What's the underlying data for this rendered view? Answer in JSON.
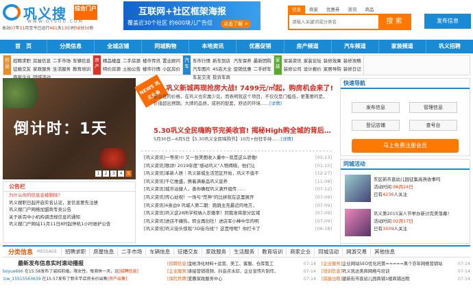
{
  "logo": {
    "name": "巩义搜",
    "sub": "综合门户",
    "url": "WWW.GYSOU.COM"
  },
  "counter": {
    "prefix": "本站",
    "year": "07",
    "mid1": "年",
    "month": "11",
    "mid2": "月至今已运行",
    "days": "461",
    "mid3": "天",
    "hours": "13",
    "mid4": "小时",
    "mins": "58",
    "mid5": "分",
    "secs": "50",
    "suffix": "秒"
  },
  "banner": {
    "title": "互联网+社区框架海报",
    "sub": "覆盖近30个社区 约600块儿广告位",
    "cta": "点击了解 >"
  },
  "search": {
    "tabs": [
      "信息",
      "商家",
      "优惠券",
      "资讯",
      "商品"
    ],
    "placeholder": "请输入关键词或分类名",
    "button": "搜 索"
  },
  "publish_button": "发布信息",
  "nav": [
    "首　页",
    "分类信息",
    "全城店铺",
    "同城购物",
    "本地资讯",
    "优惠促销",
    "房产频道",
    "汽车频道",
    "家装频道",
    "巩义招聘"
  ],
  "categories": [
    {
      "tag": "信息",
      "color": "#f08a1c",
      "links": [
        "招聘求职",
        "房屋信息",
        "二手市场",
        "车辆信息",
        "征婚交友",
        "家政服务",
        "生活服务",
        "教育培训",
        "商家企业",
        "同城活动"
      ]
    },
    {
      "tag": "房产",
      "color": "#d9322a",
      "links": [
        "精品楼盘",
        "二手房源",
        "楼市传讯",
        "置业顾问",
        "特价房源",
        "土拍公告",
        "楼市行情",
        "小区房价"
      ]
    },
    {
      "tag": "汽车",
      "color": "#1a8ad4",
      "links": [
        "车市行情",
        "新车到店",
        "汽车保养",
        "最新团购",
        "汽车图片",
        "4S店大全",
        "促销优惠",
        "二手好车",
        "车友交流",
        "投诉车商"
      ]
    },
    {
      "tag": "家装",
      "color": "#5aa832",
      "links": [
        "家装资讯",
        "家装论坛",
        "装修效果",
        "装修攻略",
        "装修公司",
        "设计报价",
        "家居导购",
        "装修日记"
      ]
    }
  ],
  "slide": {
    "text": "倒计时：1天",
    "pages": [
      "1",
      "2",
      "3",
      "4",
      "5"
    ],
    "active": 4
  },
  "notice": {
    "title": "公告栏",
    "items": [
      "为什么你的信息会被删除?",
      "巩义搜职日起开启实名认证，发信息要先注册",
      "巩义搜门户网络加盟商专卖公告",
      "关于拆完中小机构调违规信息的通知",
      "巩义搜门户网站11月11日8时起停机1小时维护公告"
    ]
  },
  "headline": {
    "badge": "NEWS 巩义头条",
    "h1": "巩义新城再现抢房大战! 7499元/㎡起，购房机会来了!",
    "d1": "这么低的价格，在巩义也实属少见。而表明就这个项目，不仅仅是门槛低，更重要的是，价值超出预期。大牌的品质，成熟的配套，舒适的环境……",
    "d1_more": "[详情]",
    "h2": "5.30巩义全民嗨购节完美收官! 揭秘High购全城的背后…",
    "d2": "5月30日—6月5日【5.30巩义全民嗨购节】10万+份狂手持……",
    "d2_more": "[详情]"
  },
  "news": [
    {
      "t": "[巩义资讯]一等奖!!! 又一张美图收入囊中~就是这么骄傲!",
      "d": "[05-13]"
    },
    {
      "t": "[巩义资讯]歌颂! 2019年度\"感动巩义\"人物揭晓，他们让",
      "d": "[01-15]"
    },
    {
      "t": "[巩义资讯]革新人居｜巩义新城生活范区开始，巩义不值不",
      "d": "[12-27]"
    },
    {
      "t": "[巩义资讯]千亿推盛，携着满春品巩义宣养",
      "d": "[11-08]"
    },
    {
      "t": "[巩义资讯]城市治捷人，善你确程巩义满开组传……",
      "d": "[07-12]"
    },
    {
      "t": "[巩义资讯]传心幼祝！一场与\"荒神\"的比拼就在这里展开",
      "d": "[07-09]"
    },
    {
      "t": "[巩义资讯]4身边9 巩城人第二期：跑跳主充最近的地方，",
      "d": "[07-09]"
    },
    {
      "t": "[巩义资讯]巩义这28所学校纳入农缴率！同我准将部分区域",
      "d": "[07-09]"
    },
    {
      "t": "[巩义资讯]进店不嫌热，转业再创社！进店军小棒中华的明",
      "d": "[07-09]"
    },
    {
      "t": "[巩义资讯]巩义街头惊现\"3D街马线\"！这是啥呢？你打卡了",
      "d": "[06-18]"
    }
  ],
  "quick": {
    "title": "快速导航",
    "items": [
      "发布信息",
      "管理信息",
      "登记店铺",
      "查号台"
    ],
    "register": "马上免费注册会员"
  },
  "activity": {
    "title": "同城活动",
    "items": [
      {
        "name": "东区新市直幼儿园征集高燕收事吗",
        "time_label": "活动时间:",
        "time": "06月24日",
        "count_prefix": "已有",
        "count": "4236",
        "count_suffix": "人关注"
      },
      {
        "name": "巩义第2015演人节举办新讨完美落幕！",
        "time_label": "活动时间:",
        "time": "02月17日",
        "count_prefix": "已有",
        "count": "3509",
        "count_suffix": "人关注"
      }
    ]
  },
  "classes": {
    "title": "分类信息",
    "en": "MESSAGE",
    "items": [
      "招聘求职",
      "房屋信息",
      "二手市场",
      "车辆信息",
      "征婚交友",
      "家政服务",
      "生活服务",
      "教育培训",
      "商家企业",
      "同城活动",
      "网游交易",
      "其他信息"
    ]
  },
  "latest": {
    "title": "最新发布信息实时滚动播报",
    "items": [
      {
        "user": "boyue666",
        "time": "在15:58发布了",
        "info": "诚招前婚，限女性，每周休一天，远",
        "tag": "[招聘信息]"
      },
      {
        "user": "1iw_15515563639",
        "time": "在15:57发布了",
        "info": "新中芊店房长价出售",
        "tag": "[房产出售]"
      }
    ]
  },
  "infolist": [
    {
      "k": "[招聘信息]",
      "t": "金帐净化材料+运营、美工、客服、仓库管工",
      "d": "07-14"
    },
    {
      "k": "[企业服务]",
      "t": "企业网站SEO优化托管=====离个亦年网络营销站",
      "d": "07-14"
    },
    {
      "k": "[企业服务]",
      "t": "承接营销视频、抖音点水印、企业宣传片制作、",
      "d": "07-14"
    },
    {
      "k": "[培训信息]",
      "t": "巩义凯达美商网络与培训",
      "d": "07-14"
    },
    {
      "k": "[保险月牌]",
      "t": "爱撒家政服务中心",
      "d": "07-14"
    },
    {
      "k": "[房屋出租]",
      "t": "建新街市直幼儿园商铺1楼商铺出租",
      "d": "07-14"
    }
  ]
}
